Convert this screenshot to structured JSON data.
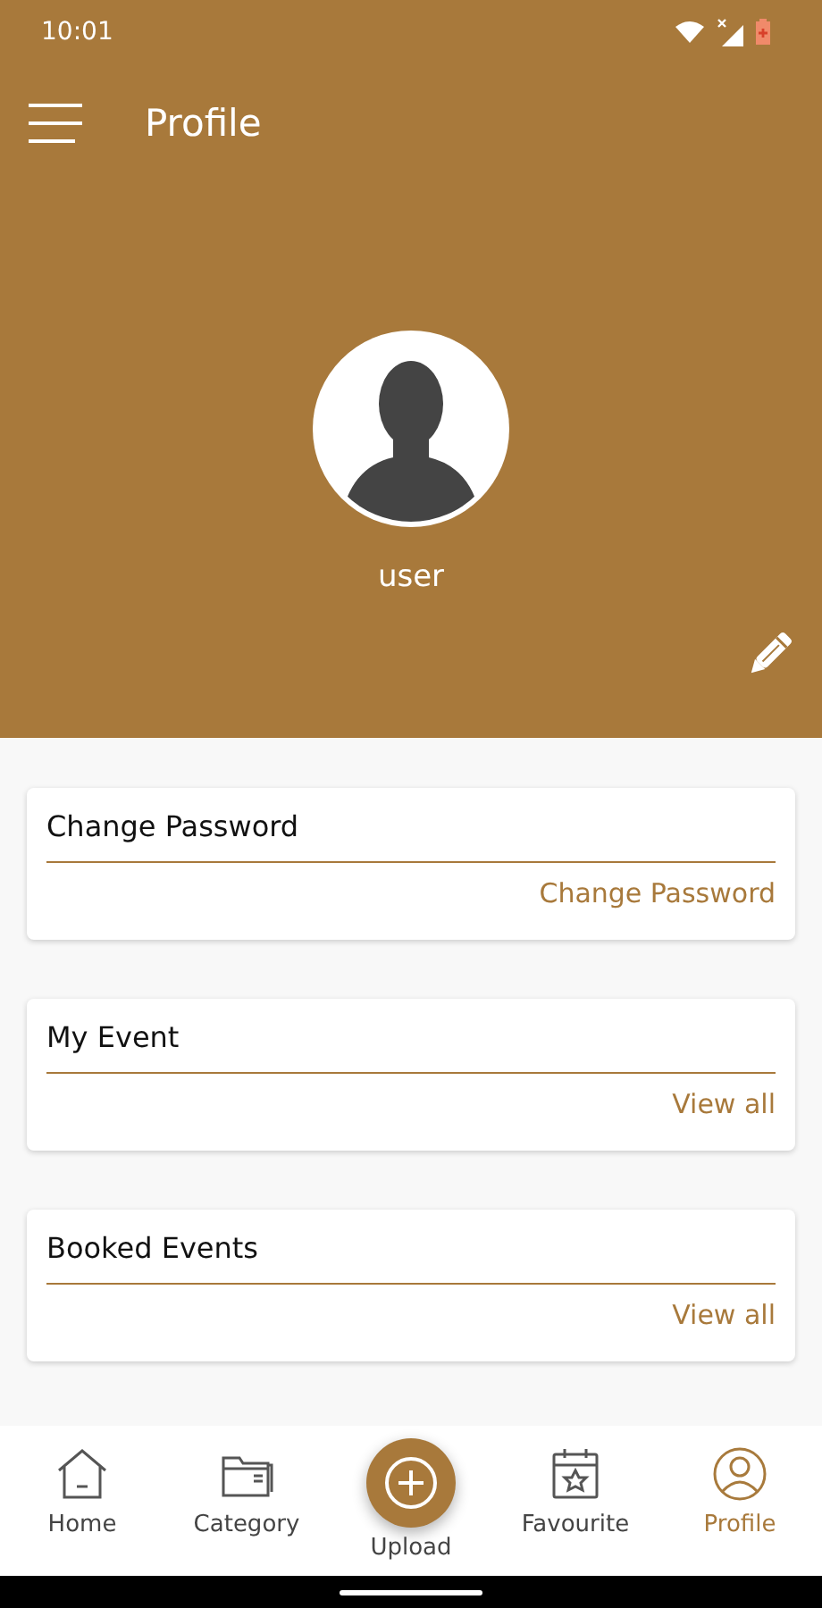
{
  "status_bar": {
    "time": "10:01"
  },
  "app_bar": {
    "title": "Profile"
  },
  "profile": {
    "name": "user"
  },
  "cards": [
    {
      "title": "Change Password",
      "action": "Change Password"
    },
    {
      "title": "My Event",
      "action": "View all"
    },
    {
      "title": "Booked Events",
      "action": "View all"
    }
  ],
  "bottom_nav": [
    {
      "label": "Home",
      "kind": "home",
      "selected": false
    },
    {
      "label": "Category",
      "kind": "category",
      "selected": false
    },
    {
      "label": "Upload",
      "kind": "fab",
      "selected": false
    },
    {
      "label": "Favourite",
      "kind": "favourite",
      "selected": false
    },
    {
      "label": "Profile",
      "kind": "profile",
      "selected": true
    }
  ]
}
